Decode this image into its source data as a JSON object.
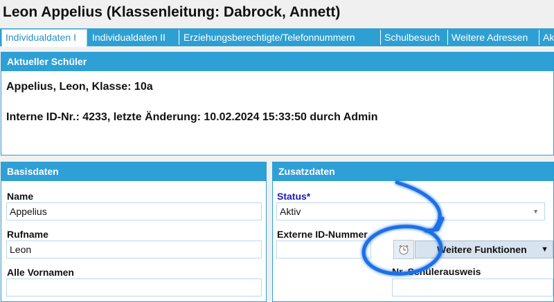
{
  "window_title": "Leon Appelius (Klassenleitung: Dabrock, Annett)",
  "tabs": [
    {
      "label": "Individualdaten I",
      "active": true
    },
    {
      "label": "Individualdaten II",
      "active": false
    },
    {
      "label": "Erziehungsberechtigte/Telefonnummern",
      "active": false
    },
    {
      "label": "Schulbesuch",
      "active": false
    },
    {
      "label": "Weitere Adressen",
      "active": false
    },
    {
      "label": "Ak",
      "active": false
    }
  ],
  "current_student": {
    "heading": "Aktueller Schüler",
    "line1": "Appelius, Leon, Klasse: 10a",
    "line2": "Interne ID-Nr.: 4233, letzte Änderung: 10.02.2024 15:33:50 durch Admin"
  },
  "basisdaten": {
    "heading": "Basisdaten",
    "name_label": "Name",
    "name_value": "Appelius",
    "rufname_label": "Rufname",
    "rufname_value": "Leon",
    "vornamen_label": "Alle Vornamen",
    "vornamen_value": ""
  },
  "zusatzdaten": {
    "heading": "Zusatzdaten",
    "status_label": "Status*",
    "status_value": "Aktiv",
    "extern_id_label": "Externe ID-Nummer",
    "extern_id_value": "",
    "weitere_funktionen_label": "Weitere Funktionen",
    "nr_ausweis_label": "Nr. Schülerausweis",
    "nr_ausweis_value": ""
  },
  "colors": {
    "accent": "#2fa0d6",
    "annotation": "#1e6fe6",
    "required_label": "#1a1ab0"
  },
  "icons": [
    "dropdown-arrow-icon",
    "alarm-clock-icon",
    "caret-down-icon",
    "annotation-arrow-icon",
    "annotation-circle-icon"
  ]
}
